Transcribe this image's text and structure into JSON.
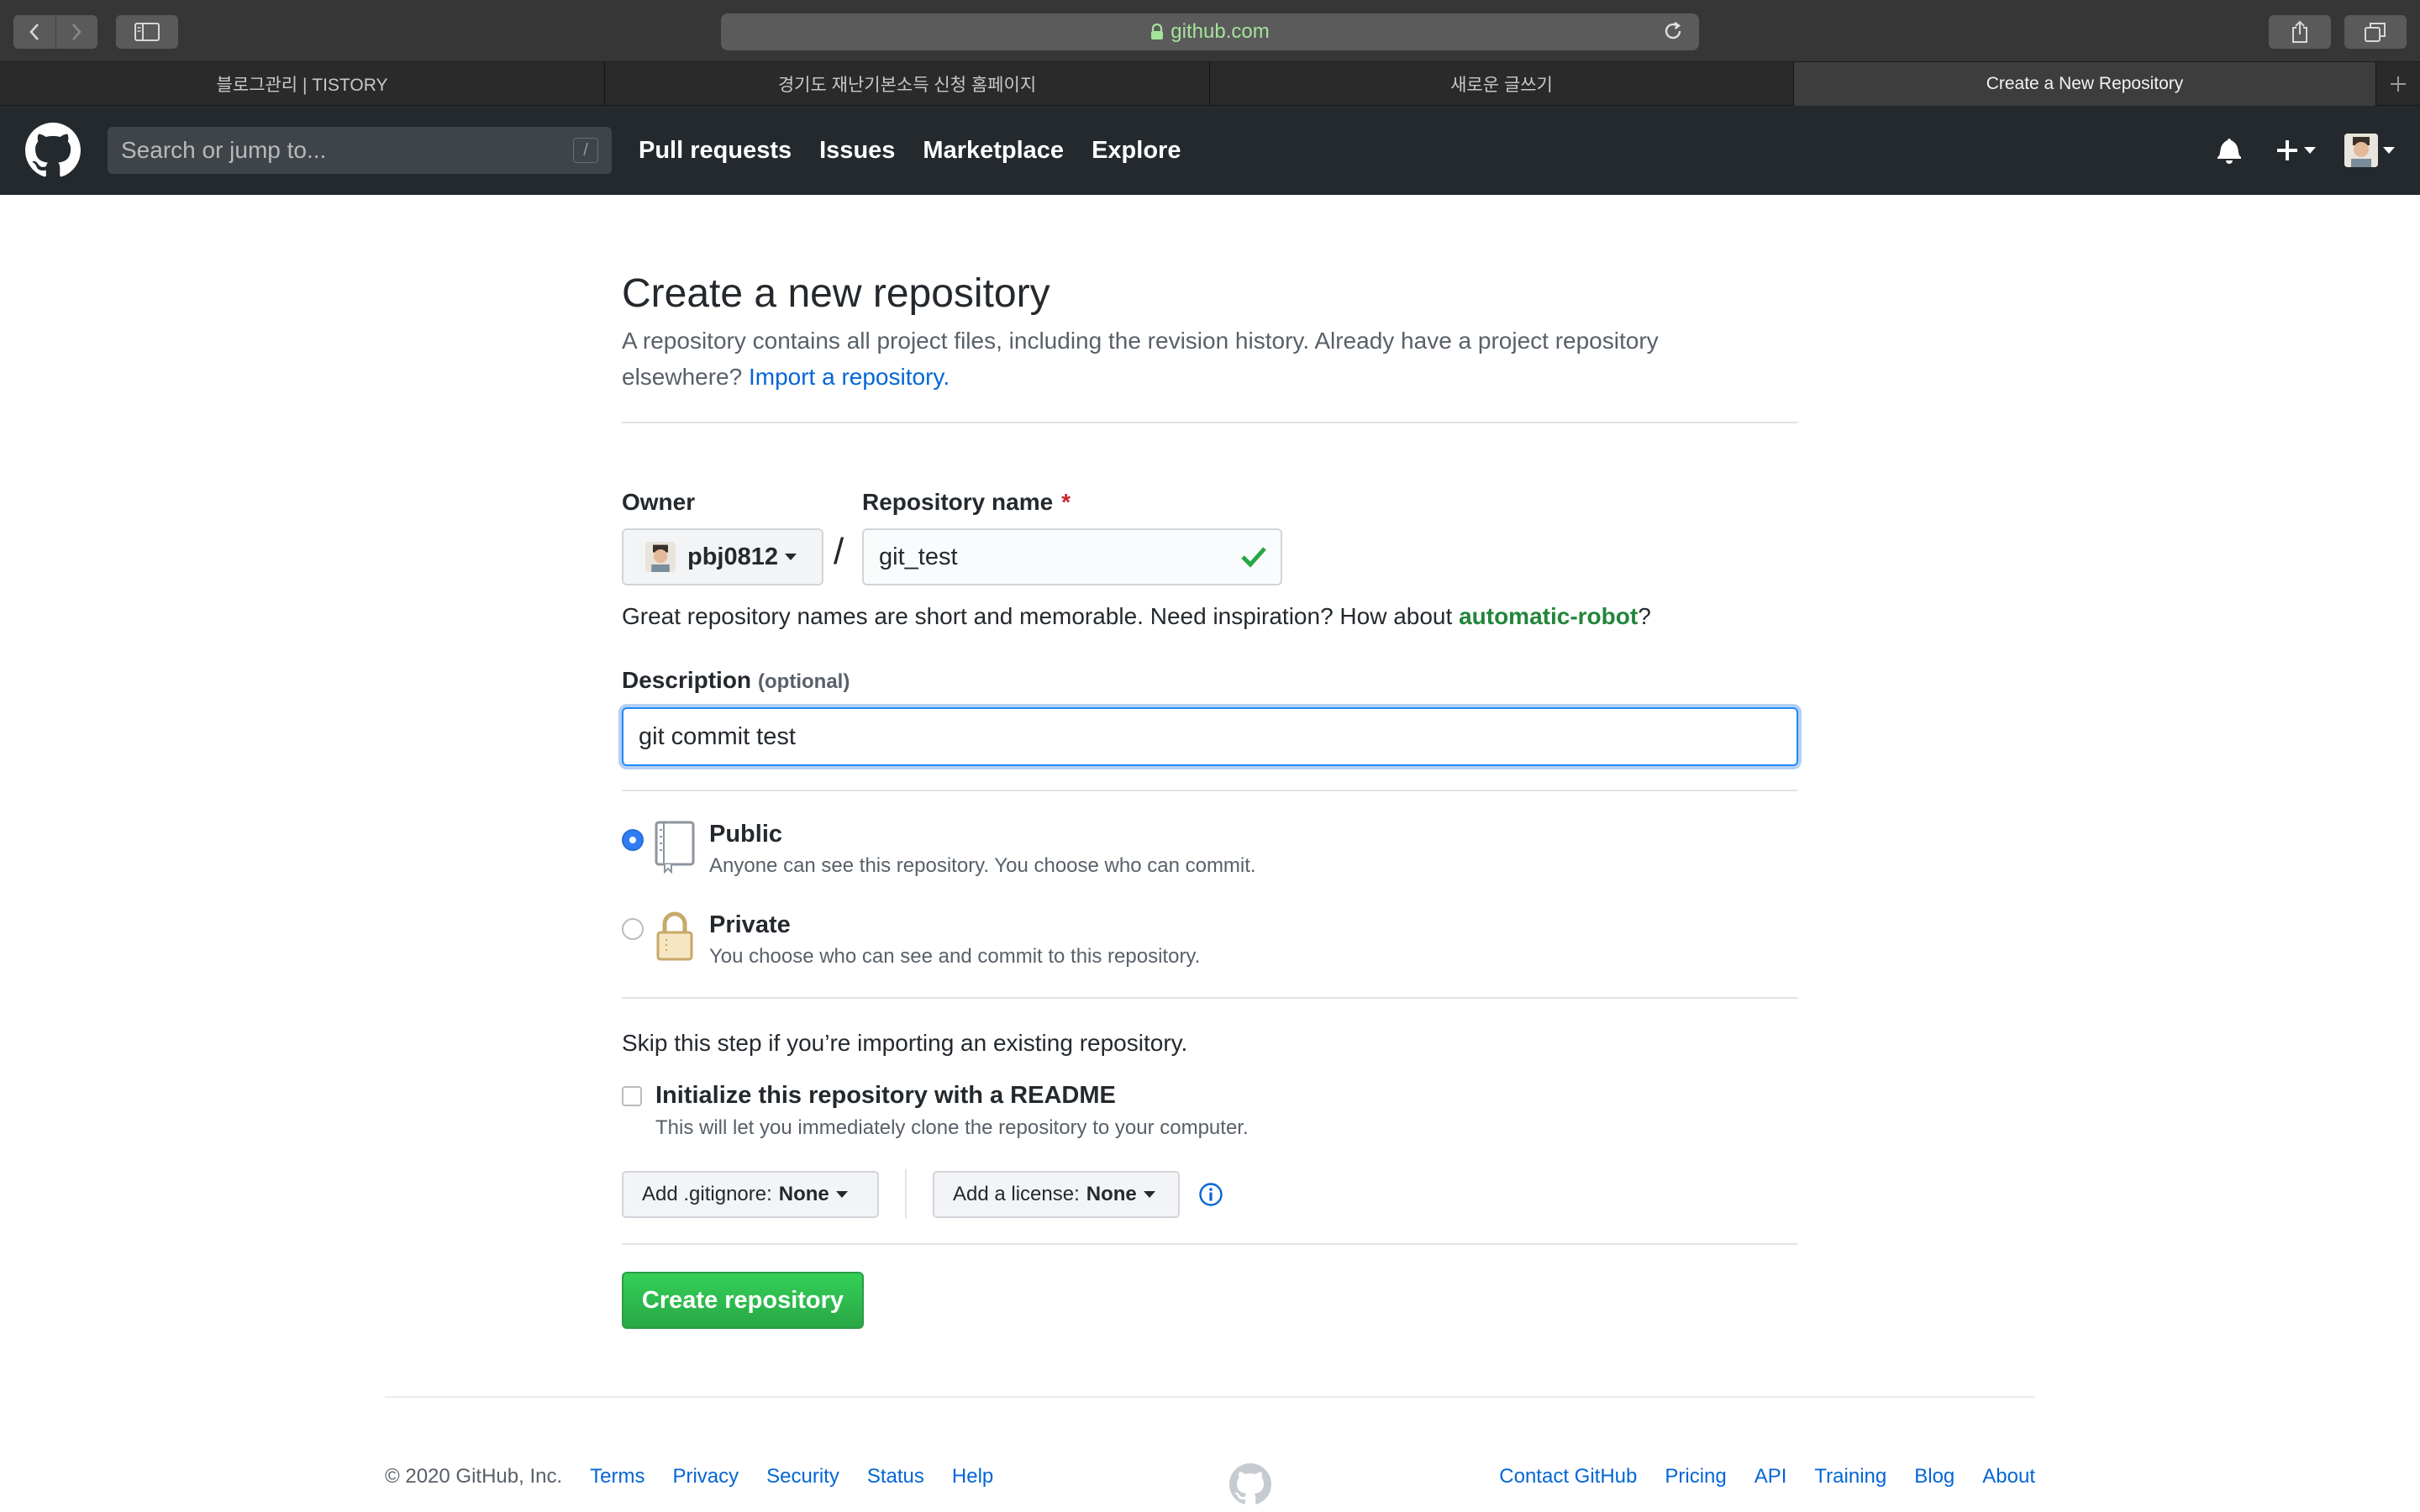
{
  "browser": {
    "url": "github.com",
    "tabs": [
      {
        "label": "블로그관리 | TISTORY",
        "active": false
      },
      {
        "label": "경기도 재난기본소득 신청 홈페이지",
        "active": false
      },
      {
        "label": "새로운 글쓰기",
        "active": false
      },
      {
        "label": "Create a New Repository",
        "active": true
      }
    ]
  },
  "header": {
    "search_placeholder": "Search or jump to...",
    "search_shortcut": "/",
    "nav": [
      "Pull requests",
      "Issues",
      "Marketplace",
      "Explore"
    ]
  },
  "page": {
    "title": "Create a new repository",
    "subtitle": "A repository contains all project files, including the revision history. Already have a project repository elsewhere?",
    "import_link": "Import a repository.",
    "owner_label": "Owner",
    "owner_value": "pbj0812",
    "separator": "/",
    "repo_name_label": "Repository name",
    "required_mark": "*",
    "repo_name_value": "git_test",
    "name_hint_prefix": "Great repository names are short and memorable. Need inspiration? How about",
    "name_suggestion": "automatic-robot",
    "name_hint_suffix": "?",
    "description_label": "Description",
    "description_optional": "(optional)",
    "description_value": "git commit test",
    "visibility": {
      "public_title": "Public",
      "public_desc": "Anyone can see this repository. You choose who can commit.",
      "private_title": "Private",
      "private_desc": "You choose who can see and commit to this repository.",
      "selected": "Public"
    },
    "skip_text": "Skip this step if you’re importing an existing repository.",
    "readme_label": "Initialize this repository with a README",
    "readme_desc": "This will let you immediately clone the repository to your computer.",
    "readme_checked": false,
    "gitignore_label": "Add .gitignore:",
    "gitignore_value": "None",
    "license_label": "Add a license:",
    "license_value": "None",
    "create_button": "Create repository"
  },
  "footer": {
    "copyright": "© 2020 GitHub, Inc.",
    "left_links": [
      "Terms",
      "Privacy",
      "Security",
      "Status",
      "Help"
    ],
    "right_links": [
      "Contact GitHub",
      "Pricing",
      "API",
      "Training",
      "Blog",
      "About"
    ]
  },
  "colors": {
    "accent_blue": "#0366d6",
    "create_green": "#28a745",
    "suggestion_green": "#22863a",
    "header_bg": "#24292e"
  }
}
